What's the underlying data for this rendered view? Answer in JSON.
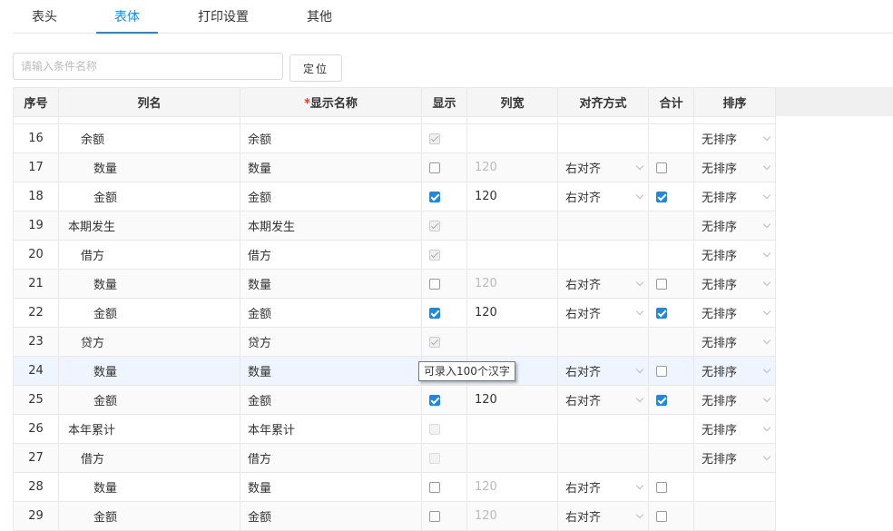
{
  "tabs": [
    {
      "label": "表头",
      "active": false
    },
    {
      "label": "表体",
      "active": true
    },
    {
      "label": "打印设置",
      "active": false
    },
    {
      "label": "其他",
      "active": false
    }
  ],
  "search": {
    "placeholder": "请输入条件名称",
    "value": ""
  },
  "locate_button": "定位",
  "table": {
    "headers": {
      "seq": "序号",
      "col_name": "列名",
      "required_mark": "*",
      "display_name": "显示名称",
      "show": "显示",
      "width": "列宽",
      "align": "对齐方式",
      "sum": "合计",
      "sort": "排序"
    },
    "rows": [
      {
        "seq": "16",
        "name": "余额",
        "indent": 1,
        "display": "余额",
        "show": "on-dis",
        "width": "",
        "width_muted": false,
        "align": "",
        "sum": "",
        "sort": "无排序"
      },
      {
        "seq": "17",
        "name": "数量",
        "indent": 2,
        "display": "数量",
        "show": "off",
        "width": "120",
        "width_muted": true,
        "align": "右对齐",
        "sum": "off",
        "sort": "无排序"
      },
      {
        "seq": "18",
        "name": "金额",
        "indent": 2,
        "display": "金额",
        "show": "on",
        "width": "120",
        "width_muted": false,
        "align": "右对齐",
        "sum": "on",
        "sort": "无排序"
      },
      {
        "seq": "19",
        "name": "本期发生",
        "indent": 0,
        "display": "本期发生",
        "show": "on-dis",
        "width": "",
        "width_muted": false,
        "align": "",
        "sum": "",
        "sort": "无排序"
      },
      {
        "seq": "20",
        "name": "借方",
        "indent": 1,
        "display": "借方",
        "show": "on-dis",
        "width": "",
        "width_muted": false,
        "align": "",
        "sum": "",
        "sort": "无排序"
      },
      {
        "seq": "21",
        "name": "数量",
        "indent": 2,
        "display": "数量",
        "show": "off",
        "width": "120",
        "width_muted": true,
        "align": "右对齐",
        "sum": "off",
        "sort": "无排序"
      },
      {
        "seq": "22",
        "name": "金额",
        "indent": 2,
        "display": "金额",
        "show": "on",
        "width": "120",
        "width_muted": false,
        "align": "右对齐",
        "sum": "on",
        "sort": "无排序"
      },
      {
        "seq": "23",
        "name": "贷方",
        "indent": 1,
        "display": "贷方",
        "show": "on-dis",
        "width": "",
        "width_muted": false,
        "align": "",
        "sum": "",
        "sort": "无排序"
      },
      {
        "seq": "24",
        "name": "数量",
        "indent": 2,
        "display": "数量",
        "show": "",
        "width": "",
        "width_muted": true,
        "align": "右对齐",
        "sum": "off",
        "sort": "无排序"
      },
      {
        "seq": "25",
        "name": "金额",
        "indent": 2,
        "display": "金额",
        "show": "on",
        "width": "120",
        "width_muted": false,
        "align": "右对齐",
        "sum": "on",
        "sort": "无排序"
      },
      {
        "seq": "26",
        "name": "本年累计",
        "indent": 0,
        "display": "本年累计",
        "show": "off-dis",
        "width": "",
        "width_muted": false,
        "align": "",
        "sum": "",
        "sort": "无排序"
      },
      {
        "seq": "27",
        "name": "借方",
        "indent": 1,
        "display": "借方",
        "show": "off-dis",
        "width": "",
        "width_muted": false,
        "align": "",
        "sum": "",
        "sort": "无排序"
      },
      {
        "seq": "28",
        "name": "数量",
        "indent": 2,
        "display": "数量",
        "show": "off",
        "width": "120",
        "width_muted": true,
        "align": "右对齐",
        "sum": "off",
        "sort": ""
      },
      {
        "seq": "29",
        "name": "金额",
        "indent": 2,
        "display": "金额",
        "show": "off",
        "width": "120",
        "width_muted": true,
        "align": "右对齐",
        "sum": "off",
        "sort": ""
      }
    ]
  },
  "tooltip": "可录入100个汉字",
  "colors": {
    "accent": "#1e88e5",
    "required": "#e53935"
  }
}
